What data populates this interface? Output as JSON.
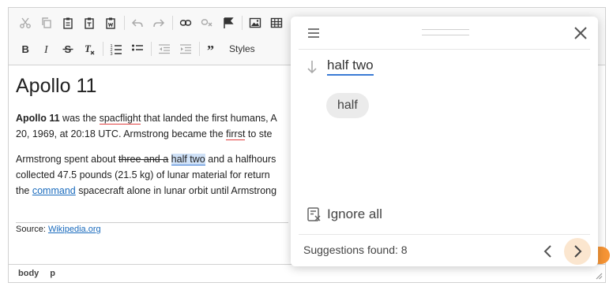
{
  "toolbar": {
    "styles_label": "Styles",
    "row1_icons": [
      "cut-icon",
      "copy-icon",
      "paste-icon",
      "paste-text-icon",
      "paste-word-icon",
      "undo-icon",
      "redo-icon",
      "link-icon",
      "unlink-icon",
      "anchor-icon",
      "image-icon",
      "table-icon"
    ],
    "row2_icons": [
      "bold-icon",
      "italic-icon",
      "strikethrough-icon",
      "remove-format-icon",
      "numbered-list-icon",
      "bulleted-list-icon",
      "outdent-icon",
      "indent-icon",
      "blockquote-icon"
    ]
  },
  "document": {
    "title": "Apollo 11",
    "p1": {
      "bold": "Apollo 11",
      "t1": " was the ",
      "err1": "spacflight",
      "t2": " that landed the first humans, A",
      "line2a": "20, 1969, at 20:18 UTC. Armstrong became the ",
      "err2": "firrst",
      "line2b": " to ste"
    },
    "p2": {
      "t1": "Armstrong spent about ",
      "strike": "three and a",
      "space": " ",
      "highlight": "half two",
      "t2": " and a halfhours",
      "line2": "collected 47.5 pounds (21.5 kg) of lunar material for return",
      "line3a": "the ",
      "link": "command",
      "line3b": " spacecraft alone in lunar orbit until Armstrong"
    },
    "source_prefix": "Source: ",
    "source_link": "Wikipedia.org"
  },
  "statusbar": {
    "path": [
      "body",
      "p"
    ]
  },
  "spell_panel": {
    "word": "half two",
    "suggestions": [
      "half"
    ],
    "ignore_all_label": "Ignore all",
    "count_label": "Suggestions found: 8"
  },
  "colors": {
    "accent": "#3a7bd5",
    "error_underline": "#e03e3e",
    "orange": "#f79535"
  }
}
